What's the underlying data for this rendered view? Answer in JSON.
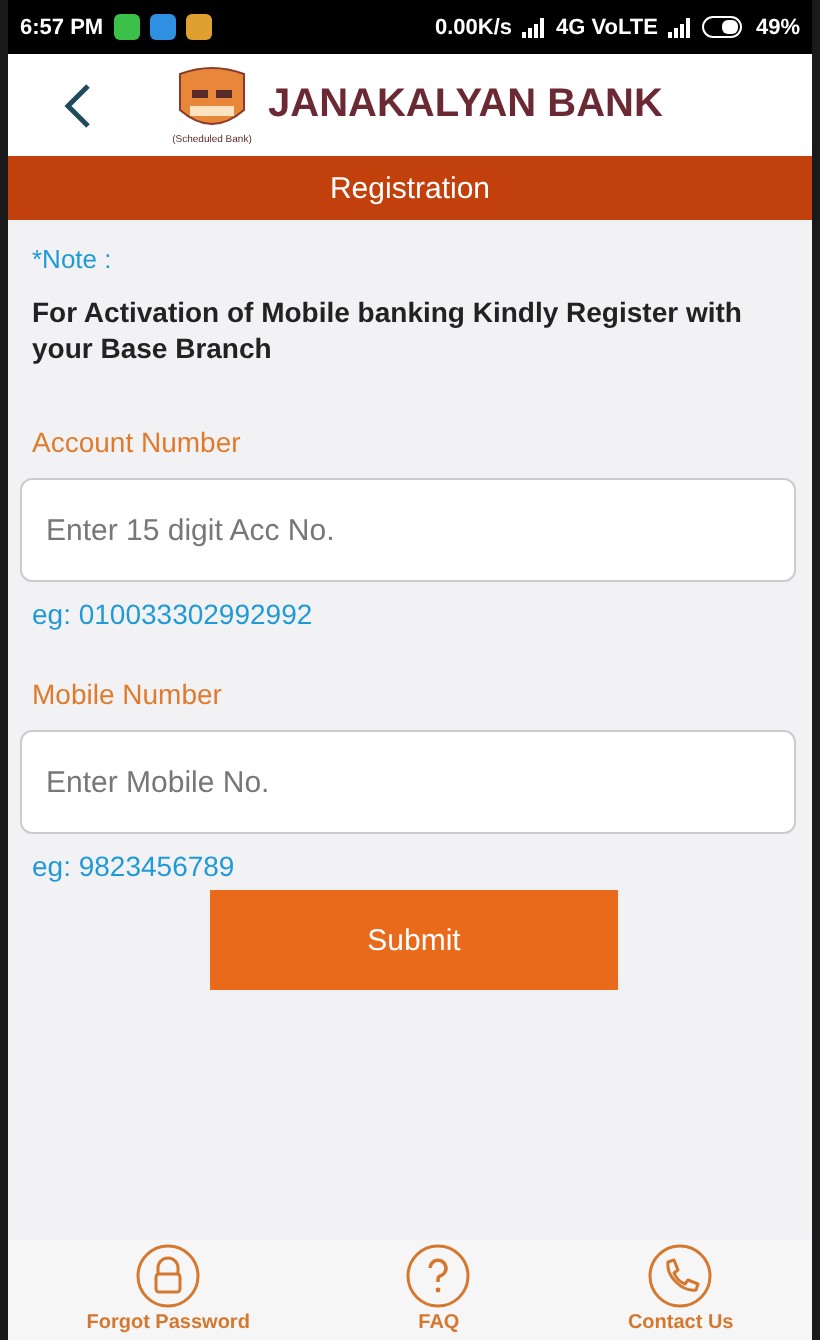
{
  "status_bar": {
    "time": "6:57 PM",
    "network_speed": "0.00K/s",
    "network": "4G VoLTE",
    "battery": "49%"
  },
  "header": {
    "title": "JANAKALYAN BANK",
    "logo_caption": "(Scheduled Bank)"
  },
  "title_bar": {
    "title": "Registration"
  },
  "note": {
    "label": "*Note :",
    "text": "For Activation of Mobile banking Kindly Register with your Base Branch"
  },
  "fields": [
    {
      "label": "Account Number",
      "placeholder": "Enter 15 digit Acc No.",
      "example": "eg: 010033302992992"
    },
    {
      "label": "Mobile Number",
      "placeholder": "Enter Mobile No.",
      "example": "eg: 9823456789"
    }
  ],
  "submit": "Submit",
  "bottom_nav": [
    {
      "kind": "lock",
      "label": "Forgot Password"
    },
    {
      "kind": "question",
      "label": "FAQ"
    },
    {
      "kind": "phone",
      "label": "Contact Us"
    }
  ]
}
